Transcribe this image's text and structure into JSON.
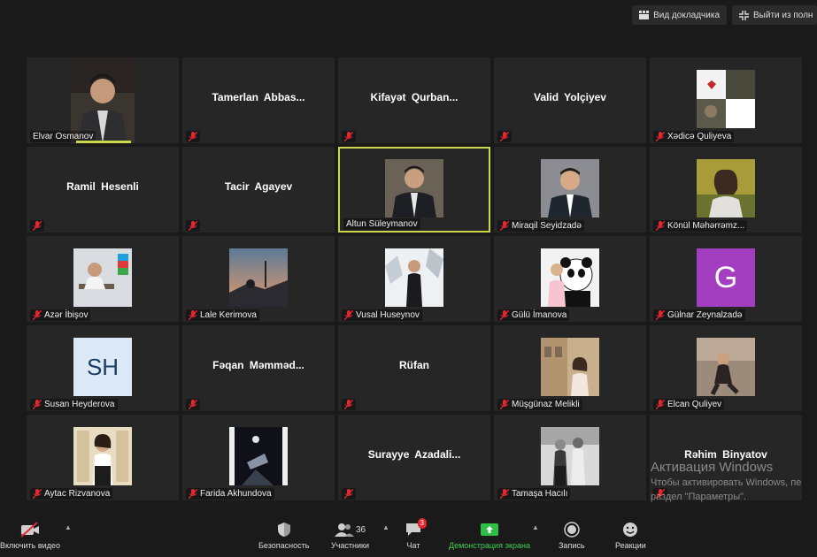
{
  "top": {
    "speaker_view": "Вид докладчика",
    "exit_full": "Выйти из полн"
  },
  "tiles": [
    {
      "name": "Elvar Osmanov"
    },
    {
      "name": "Tamerlan  Abbas..."
    },
    {
      "name": "Kifayət  Qurban..."
    },
    {
      "name": "Valid Yolçiyev"
    },
    {
      "name": "Xədicə Quliyeva"
    },
    {
      "name": "Ramil Hesenli"
    },
    {
      "name": "Tacir Agayev"
    },
    {
      "name": "Altun Süleymanov"
    },
    {
      "name": "Miraqil Seyidzadə"
    },
    {
      "name": "Könül Məhərrəmz..."
    },
    {
      "name": "Azər İbişov"
    },
    {
      "name": "Lale Kerimova"
    },
    {
      "name": "Vusal Huseynov"
    },
    {
      "name": "Gülü İmanova"
    },
    {
      "name": "Gülnar Zeynalzadə",
      "avatar_letter": "G"
    },
    {
      "name": "Susan Heyderova",
      "avatar_letter": "SH"
    },
    {
      "name": "Fəqan  Məmməd..."
    },
    {
      "name": "Rüfan"
    },
    {
      "name": "Müşgünaz Melikli"
    },
    {
      "name": "Elcan Quliyev"
    },
    {
      "name": "Aytac Rizvanova"
    },
    {
      "name": "Farida Akhundova"
    },
    {
      "name": "Surayye  Azadali..."
    },
    {
      "name": "Tamaşa Hacılı"
    },
    {
      "name": "Rəhim Binyatov"
    }
  ],
  "activation": {
    "title": "Активация Windows",
    "line1": "Чтобы активировать Windows, пе",
    "line2": "раздел \"Параметры\"."
  },
  "toolbar": {
    "video": "Включить видео",
    "security": "Безопасность",
    "participants": "Участники",
    "participants_count": "36",
    "chat": "Чат",
    "chat_badge": "3",
    "share": "Демонстрация экрана",
    "record": "Запись",
    "reactions": "Реакции"
  },
  "colors": {
    "active_border": "#c9d84a",
    "mute_red": "#e0282f",
    "share_green": "#3ecf4e"
  }
}
